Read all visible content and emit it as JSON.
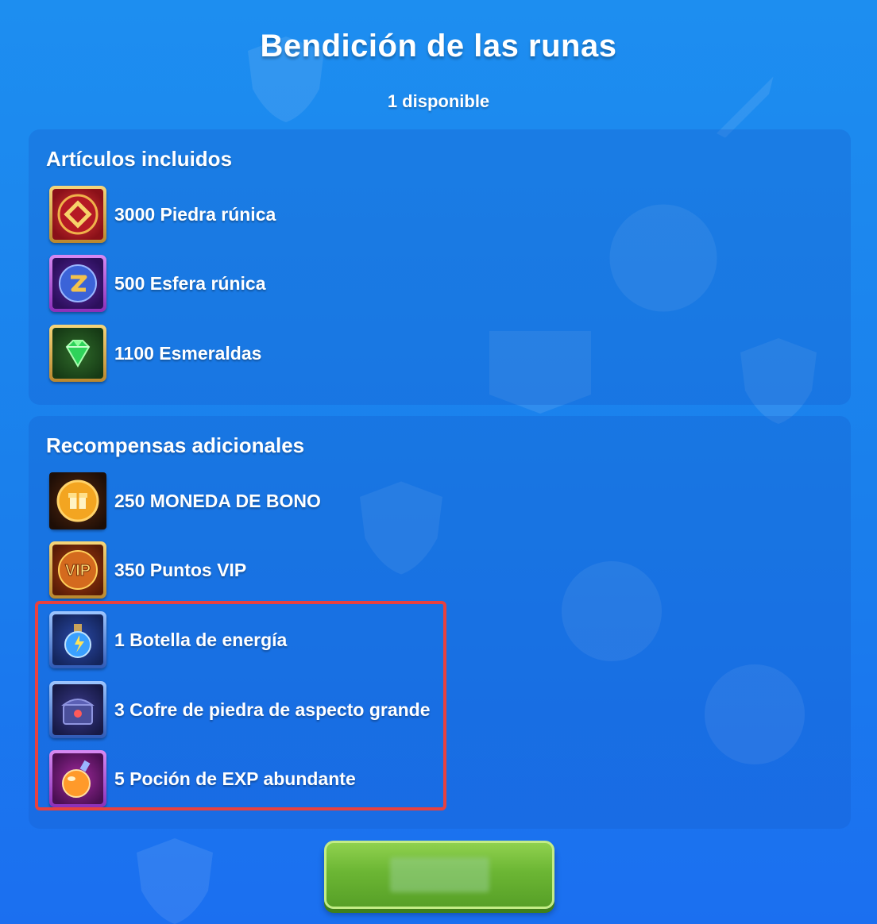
{
  "header": {
    "title": "Bendición de las runas",
    "availability": "1 disponible"
  },
  "included_section": {
    "title": "Artículos incluidos",
    "items": [
      {
        "label": "3000 Piedra rúnica",
        "icon": "rune-stone-icon"
      },
      {
        "label": "500 Esfera rúnica",
        "icon": "rune-sphere-icon"
      },
      {
        "label": "1100 Esmeraldas",
        "icon": "emerald-icon"
      }
    ]
  },
  "bonus_section": {
    "title": "Recompensas adicionales",
    "items": [
      {
        "label": "250 MONEDA DE BONO",
        "icon": "bonus-coin-icon"
      },
      {
        "label": "350 Puntos VIP",
        "icon": "vip-points-icon"
      },
      {
        "label": "1 Botella de energía",
        "icon": "energy-bottle-icon"
      },
      {
        "label": "3 Cofre de piedra de aspecto grande",
        "icon": "stone-chest-icon"
      },
      {
        "label": "5 Poción de EXP abundante",
        "icon": "exp-potion-icon"
      }
    ]
  },
  "colors": {
    "background": "#1a7fec",
    "highlight_border": "#e8413f",
    "button_green": "#6cb634"
  },
  "icon_text": {
    "vip": "VIP"
  }
}
